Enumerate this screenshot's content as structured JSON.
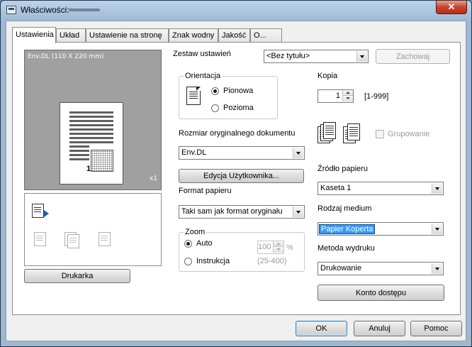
{
  "window": {
    "title": "Właściwości:",
    "close_label": "✕"
  },
  "tabs": [
    {
      "label": "Ustawienia"
    },
    {
      "label": "Układ"
    },
    {
      "label": "Ustawienie na stronę"
    },
    {
      "label": "Znak wodny"
    },
    {
      "label": "Jakość"
    },
    {
      "label": "O..."
    }
  ],
  "preview": {
    "paper_label": "Env.DL  (110 X 220 mm)",
    "copies_indicator": "x1",
    "page_number": "1"
  },
  "printer_button": "Drukarka",
  "presets": {
    "label": "Zestaw ustawień",
    "value": "<Bez tytułu>",
    "save_label": "Zachowaj"
  },
  "orientation": {
    "title": "Orientacja",
    "portrait_label": "Pionowa",
    "landscape_label": "Pozioma",
    "selected": "Pionowa"
  },
  "original_size": {
    "label": "Rozmiar oryginalnego dokumentu",
    "value": "Env.DL",
    "user_edit_label": "Edycja Użytkownika..."
  },
  "paper_format": {
    "label": "Format papieru",
    "value": "Taki sam jak format oryginału"
  },
  "zoom": {
    "title": "Zoom",
    "auto_label": "Auto",
    "manual_label": "Instrukcja",
    "value": "100",
    "unit": "%",
    "range": "(25-400)",
    "selected": "Auto"
  },
  "copies": {
    "label": "Kopia",
    "value": "1",
    "range": "[1-999]",
    "collate_label": "Grupowanie"
  },
  "paper_source": {
    "label": "Źródło papieru",
    "value": "Kaseta 1"
  },
  "media_type": {
    "label": "Rodzaj medium",
    "value": "Papier Koperta"
  },
  "output_method": {
    "label": "Metoda wydruku",
    "value": "Drukowanie",
    "account_label": "Konto dostępu"
  },
  "footer": {
    "ok_label": "OK",
    "cancel_label": "Anuluj",
    "help_label": "Pomoc"
  }
}
